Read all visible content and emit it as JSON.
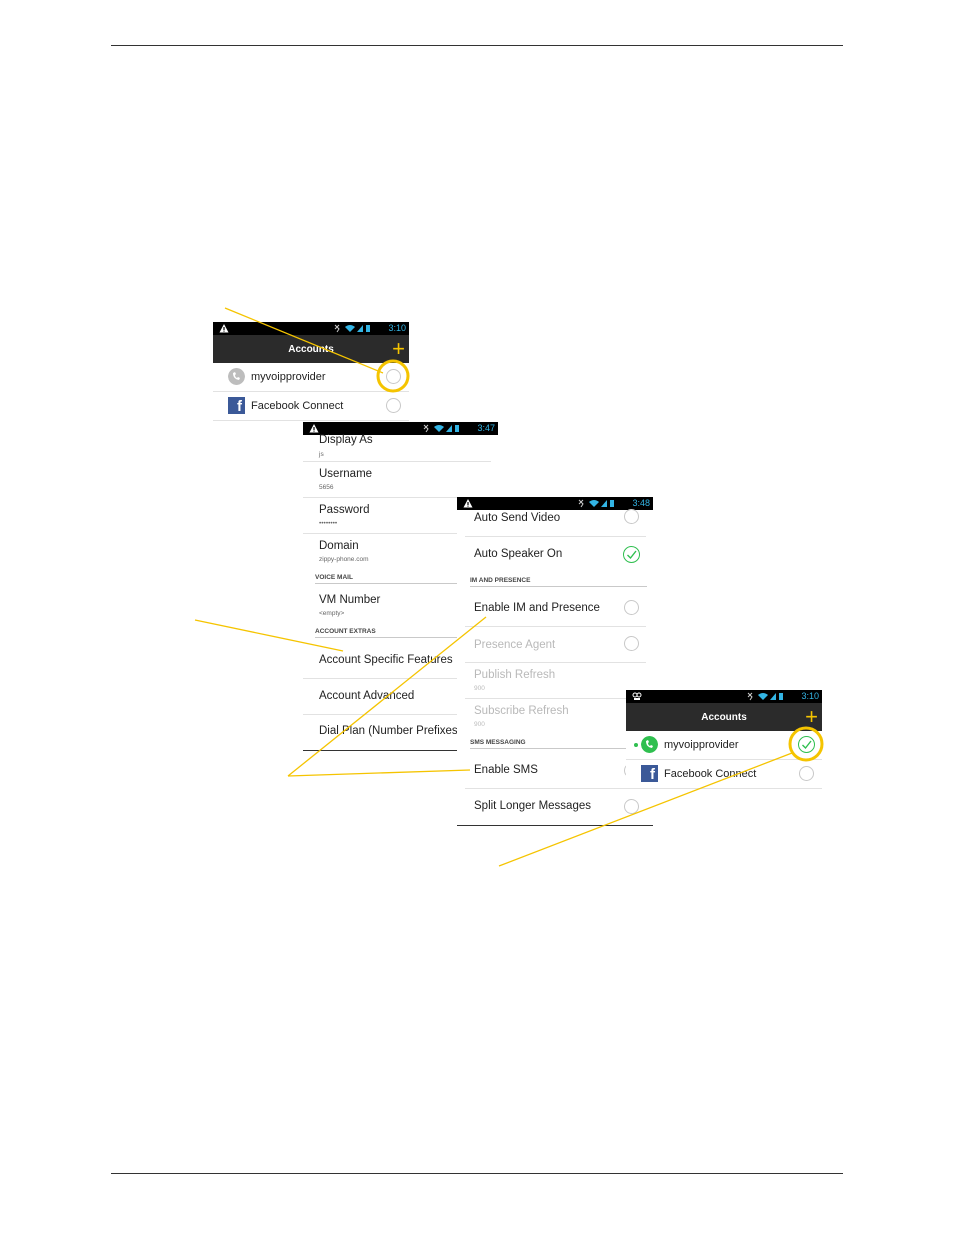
{
  "colors": {
    "statusbar_text": "#33b5e5",
    "actionbar": "#2b2b2b",
    "accent_plus": "#f5c400",
    "callout": "#f5c400",
    "check_green": "#2fbf4f",
    "facebook_blue": "#3b5998"
  },
  "screen1": {
    "time": "3:10",
    "title": "Accounts",
    "add_icon": "plus-icon",
    "accounts": [
      {
        "name": "myvoipprovider",
        "icon": "phone-icon",
        "enabled": false
      },
      {
        "name": "Facebook Connect",
        "icon": "facebook-icon",
        "enabled": false
      }
    ]
  },
  "screen2": {
    "time": "3:47",
    "items": [
      {
        "label": "Display As",
        "sub": "js"
      },
      {
        "label": "Username",
        "sub": "5656"
      },
      {
        "label": "Password",
        "sub": "••••••••"
      },
      {
        "label": "Domain",
        "sub": "zippy-phone.com"
      }
    ],
    "section_voicemail": "VOICE MAIL",
    "vm": {
      "label": "VM Number",
      "sub": "<empty>"
    },
    "section_extras": "ACCOUNT EXTRAS",
    "extras": [
      {
        "label": "Account Specific Features"
      },
      {
        "label": "Account Advanced"
      },
      {
        "label": "Dial Plan (Number Prefixes)"
      }
    ]
  },
  "screen3": {
    "time": "3:48",
    "auto_send_video": "Auto Send Video",
    "auto_speaker_on": "Auto Speaker On",
    "section_im": "IM AND PRESENCE",
    "enable_im": "Enable IM and Presence",
    "presence_agent": "Presence Agent",
    "publish_refresh": {
      "label": "Publish Refresh",
      "sub": "900"
    },
    "subscribe_refresh": {
      "label": "Subscribe Refresh",
      "sub": "900"
    },
    "section_sms": "SMS MESSAGING",
    "enable_sms": "Enable SMS",
    "split_longer": "Split Longer Messages"
  },
  "screen4": {
    "time": "3:10",
    "title": "Accounts",
    "add_icon": "plus-icon",
    "accounts": [
      {
        "name": "myvoipprovider",
        "icon": "phone-icon",
        "enabled": true
      },
      {
        "name": "Facebook Connect",
        "icon": "facebook-icon",
        "enabled": false
      }
    ]
  }
}
